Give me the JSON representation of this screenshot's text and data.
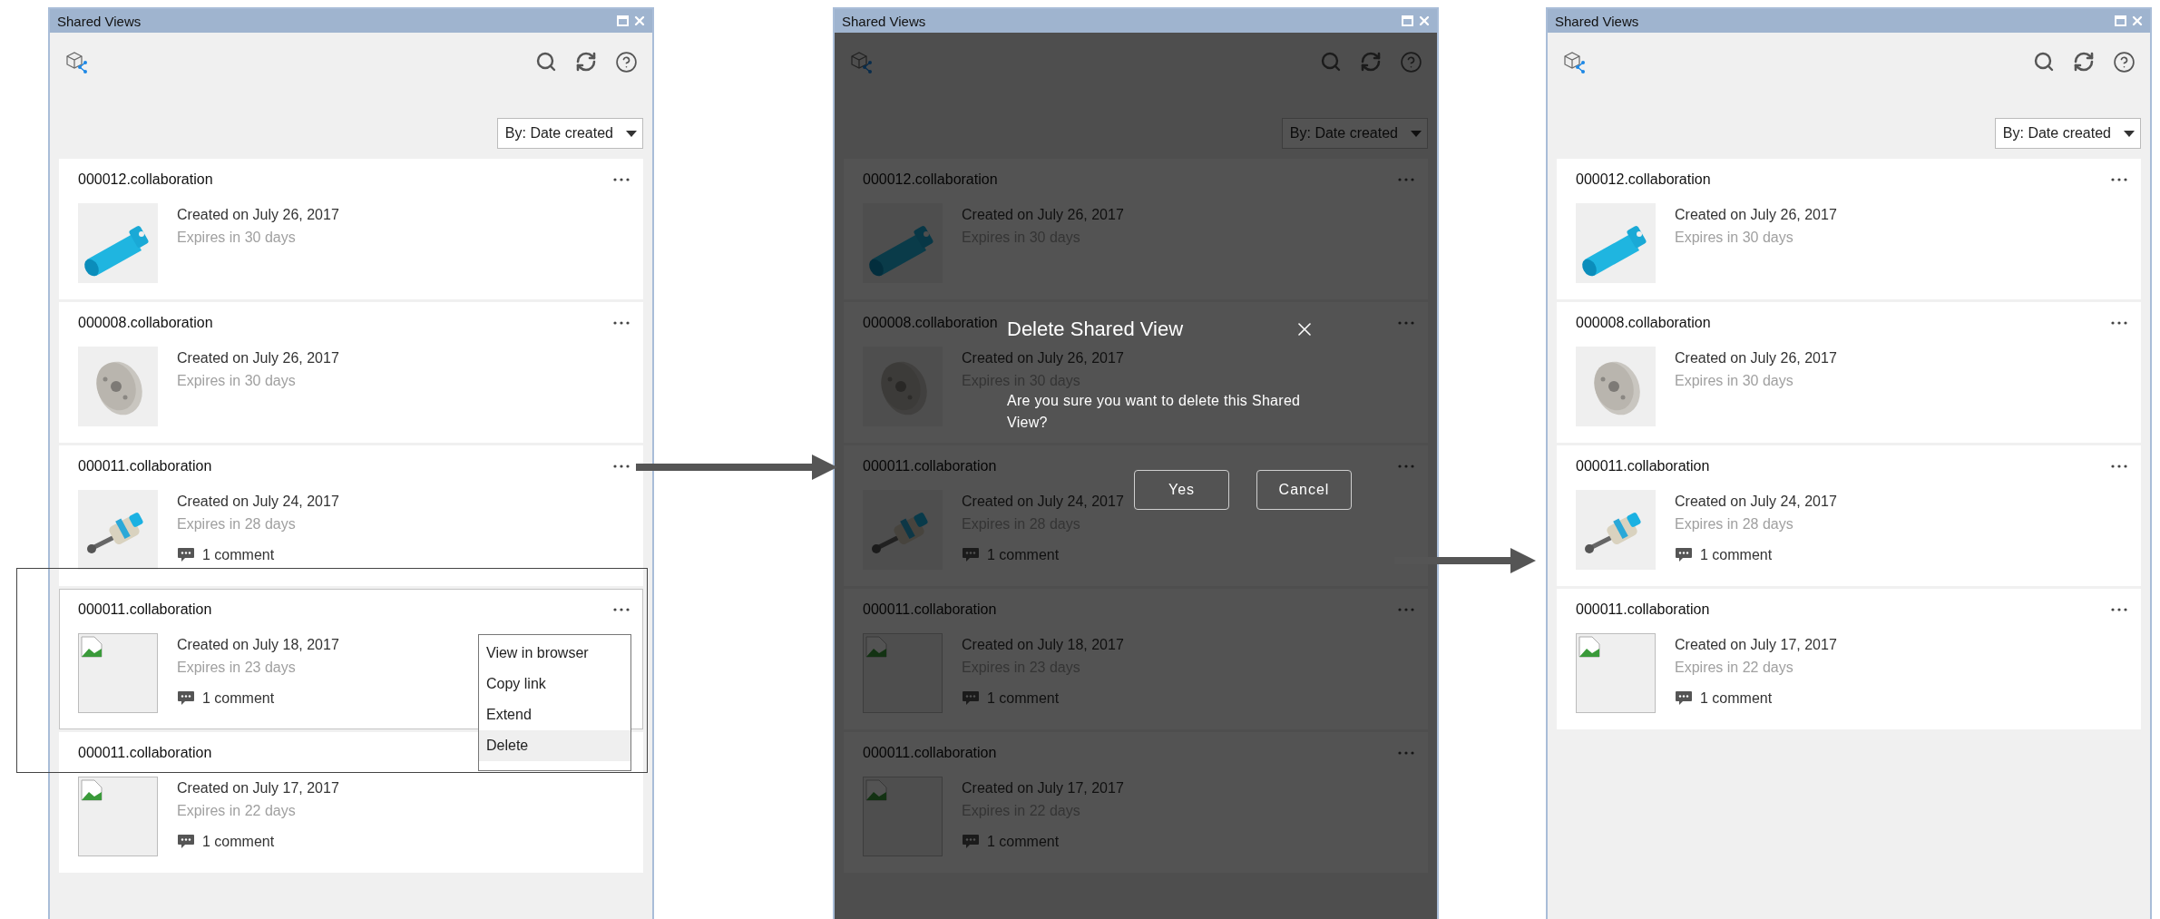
{
  "panels": [
    {
      "title": "Shared Views",
      "sort": "By: Date created",
      "views": [
        {
          "kind": "picture",
          "name": "000012.collaboration",
          "created": "Created on July 26, 2017",
          "expires": "Expires in 30 days",
          "selected": false
        },
        {
          "kind": "picture",
          "name": "000008.collaboration",
          "created": "Created on July 26, 2017",
          "expires": "Expires in 30 days",
          "selected": false
        },
        {
          "kind": "picture",
          "name": "000011.collaboration",
          "created": "Created on July 24, 2017",
          "expires": "Expires in 28 days",
          "comments": "1 comment",
          "selected": false
        },
        {
          "kind": "missing",
          "name": "000011.collaboration",
          "created": "Created on July 18, 2017",
          "expires": "Expires in 23 days",
          "comments": "1 comment",
          "selected": true,
          "menu": [
            {
              "label": "View in browser",
              "selected": false
            },
            {
              "label": "Copy link",
              "selected": false
            },
            {
              "label": "Extend",
              "selected": false
            },
            {
              "label": "Delete",
              "selected": true
            }
          ]
        },
        {
          "kind": "missing",
          "name": "000011.collaboration",
          "created": "Created on July 17, 2017",
          "expires": "Expires in 22 days",
          "comments": "1 comment",
          "selected": false
        }
      ]
    },
    {
      "title": "Shared Views",
      "sort": "By: Date created",
      "views": [
        {
          "kind": "picture",
          "name": "000012.collaboration",
          "created": "Created on July 26, 2017",
          "expires": "Expires in 30 days",
          "selected": false
        },
        {
          "kind": "picture",
          "name": "000008.collaboration",
          "created": "Created on July 26, 2017",
          "expires": "Expires in 30 days",
          "selected": false
        },
        {
          "kind": "picture",
          "name": "000011.collaboration",
          "created": "Created on July 24, 2017",
          "expires": "Expires in 28 days",
          "comments": "1 comment",
          "selected": false
        },
        {
          "kind": "missing",
          "name": "000011.collaboration",
          "created": "Created on July 18, 2017",
          "expires": "Expires in 23 days",
          "comments": "1 comment",
          "selected": false
        },
        {
          "kind": "missing",
          "name": "000011.collaboration",
          "created": "Created on July 17, 2017",
          "expires": "Expires in 22 days",
          "comments": "1 comment",
          "selected": false
        }
      ],
      "dialog": {
        "title": "Delete Shared View",
        "message": "Are you sure you want to delete this Shared View?",
        "buttons": [
          "Yes",
          "Cancel"
        ]
      }
    },
    {
      "title": "Shared Views",
      "sort": "By: Date created",
      "views": [
        {
          "kind": "picture",
          "name": "000012.collaboration",
          "created": "Created on July 26, 2017",
          "expires": "Expires in 30 days",
          "selected": false
        },
        {
          "kind": "picture",
          "name": "000008.collaboration",
          "created": "Created on July 26, 2017",
          "expires": "Expires in 30 days",
          "selected": false
        },
        {
          "kind": "picture",
          "name": "000011.collaboration",
          "created": "Created on July 24, 2017",
          "expires": "Expires in 28 days",
          "comments": "1 comment",
          "selected": false
        },
        {
          "kind": "missing",
          "name": "000011.collaboration",
          "created": "Created on July 17, 2017",
          "expires": "Expires in 22 days",
          "comments": "1 comment",
          "selected": false
        }
      ]
    }
  ]
}
